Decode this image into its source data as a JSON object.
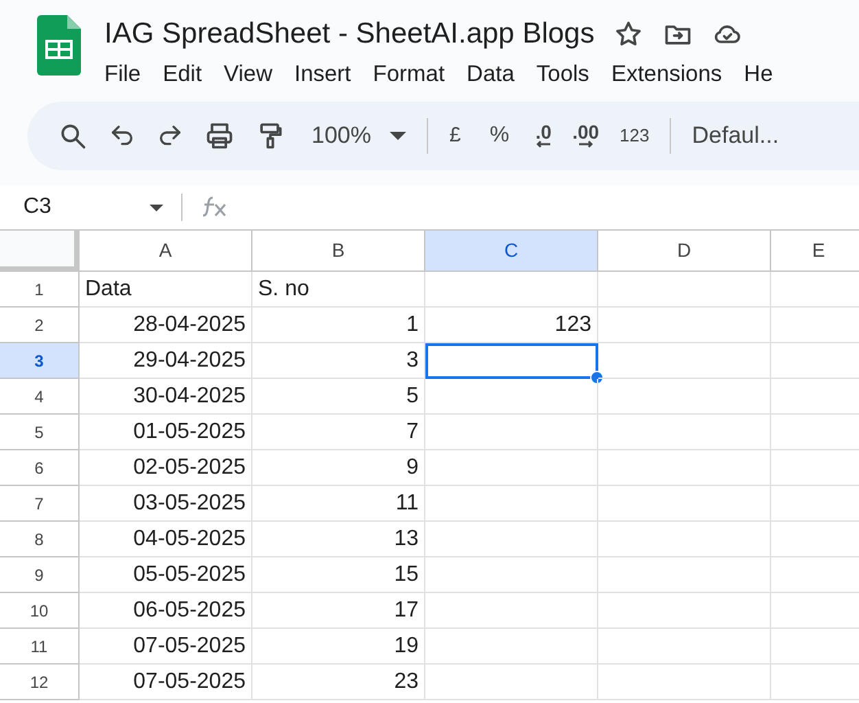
{
  "title": "IAG SpreadSheet - SheetAI.app Blogs",
  "menu": [
    "File",
    "Edit",
    "View",
    "Insert",
    "Format",
    "Data",
    "Tools",
    "Extensions",
    "He"
  ],
  "toolbar": {
    "zoom": "100%",
    "currency": "£",
    "percent": "%",
    "decrease_decimal": ".0",
    "increase_decimal": ".00",
    "number_format": "123",
    "font": "Defaul..."
  },
  "name_box": "C3",
  "columns": [
    {
      "label": "A",
      "selected": false
    },
    {
      "label": "B",
      "selected": false
    },
    {
      "label": "C",
      "selected": true
    },
    {
      "label": "D",
      "selected": false
    },
    {
      "label": "E",
      "selected": false
    }
  ],
  "rows": [
    {
      "number": "1",
      "selected": false,
      "cells": {
        "A": "Data",
        "B": "S. no"
      }
    },
    {
      "number": "2",
      "selected": false,
      "cells": {
        "A": "28-04-2025",
        "B": "1",
        "C": "123"
      }
    },
    {
      "number": "3",
      "selected": true,
      "cells": {
        "A": "29-04-2025",
        "B": "3"
      }
    },
    {
      "number": "4",
      "selected": false,
      "cells": {
        "A": "30-04-2025",
        "B": "5"
      }
    },
    {
      "number": "5",
      "selected": false,
      "cells": {
        "A": "01-05-2025",
        "B": "7"
      }
    },
    {
      "number": "6",
      "selected": false,
      "cells": {
        "A": "02-05-2025",
        "B": "9"
      }
    },
    {
      "number": "7",
      "selected": false,
      "cells": {
        "A": "03-05-2025",
        "B": "11"
      }
    },
    {
      "number": "8",
      "selected": false,
      "cells": {
        "A": "04-05-2025",
        "B": "13"
      }
    },
    {
      "number": "9",
      "selected": false,
      "cells": {
        "A": "05-05-2025",
        "B": "15"
      }
    },
    {
      "number": "10",
      "selected": false,
      "cells": {
        "A": "06-05-2025",
        "B": "17"
      }
    },
    {
      "number": "11",
      "selected": false,
      "cells": {
        "A": "07-05-2025",
        "B": "19"
      }
    },
    {
      "number": "12",
      "selected": false,
      "cells": {
        "A": "07-05-2025",
        "B": "23"
      }
    }
  ]
}
